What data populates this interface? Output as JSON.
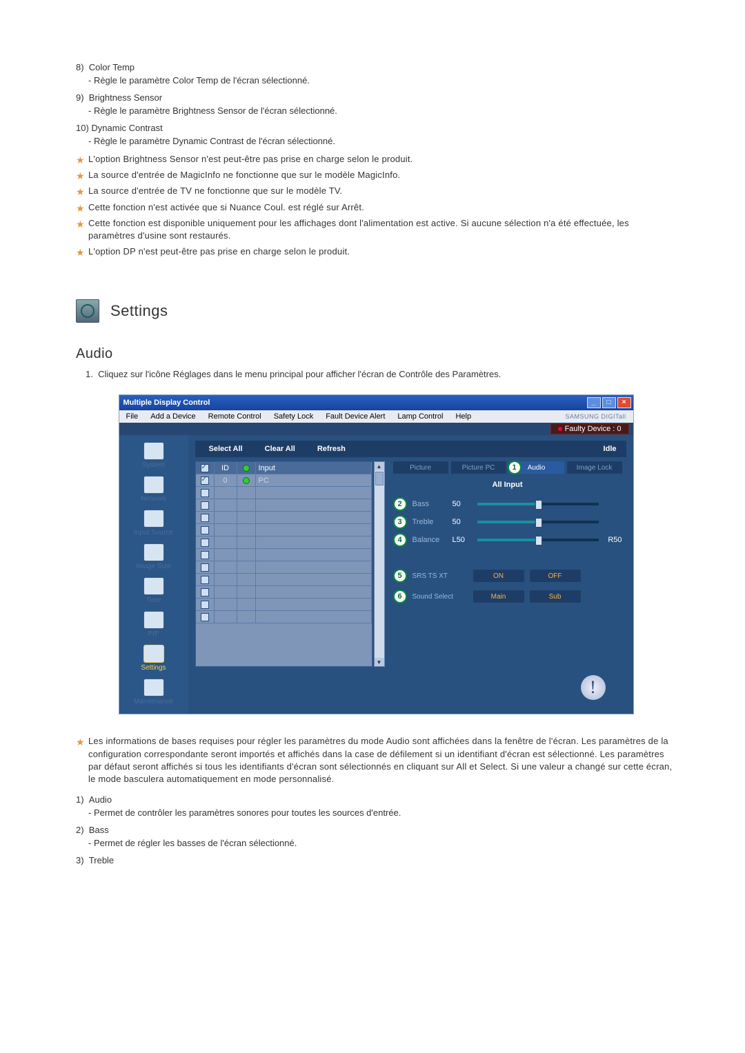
{
  "top_list": [
    {
      "num": "8)",
      "title": "Color Temp",
      "desc": "- Règle le paramètre Color Temp de l'écran sélectionné."
    },
    {
      "num": "9)",
      "title": "Brightness Sensor",
      "desc": "- Règle le paramètre Brightness Sensor de l'écran sélectionné."
    },
    {
      "num": "10)",
      "title": "Dynamic Contrast",
      "desc": "- Règle le paramètre Dynamic Contrast de l'écran sélectionné."
    }
  ],
  "star_notes": [
    "L'option Brightness Sensor n'est peut-être pas prise en charge selon le produit.",
    "La source d'entrée de MagicInfo ne fonctionne que sur le modèle MagicInfo.",
    "La source d'entrée de TV ne fonctionne que sur le modèle TV.",
    "Cette fonction n'est activée que si Nuance Coul. est réglé sur Arrêt.",
    "Cette fonction est disponible uniquement pour les affichages dont l'alimentation est active. Si aucune sélection n'a été effectuée, les paramètres d'usine sont restaurés.",
    "L'option DP n'est peut-être pas prise en charge selon le produit."
  ],
  "section_title": "Settings",
  "audio_heading": "Audio",
  "audio_intro_num": "1.",
  "audio_intro": "Cliquez sur l'icône Réglages dans le menu principal pour afficher l'écran de Contrôle des Paramètres.",
  "shot": {
    "title": "Multiple Display Control",
    "menu": [
      "File",
      "Add a Device",
      "Remote Control",
      "Safety Lock",
      "Fault Device Alert",
      "Lamp Control",
      "Help"
    ],
    "brand": "SAMSUNG DIGITall",
    "faulty": "Faulty Device : 0",
    "toolbar": {
      "select_all": "Select All",
      "clear_all": "Clear All",
      "refresh": "Refresh",
      "idle": "Idle"
    },
    "sidebar": [
      "System",
      "Network",
      "Input Source",
      "Image Size",
      "Time",
      "PIP",
      "Settings",
      "Maintenance"
    ],
    "grid_headers": {
      "c2": "ID",
      "c4": "Input"
    },
    "grid_row": {
      "id": "0",
      "input": "PC"
    },
    "tabs": [
      "Picture",
      "Picture PC",
      "Audio",
      "Image Lock"
    ],
    "all_input": "All Input",
    "sliders": {
      "bass": {
        "label": "Bass",
        "value": "50"
      },
      "treble": {
        "label": "Treble",
        "value": "50"
      },
      "balance": {
        "label": "Balance",
        "left": "L50",
        "right": "R50"
      }
    },
    "opts": {
      "srs": {
        "label": "SRS TS XT",
        "on": "ON",
        "off": "OFF"
      },
      "sound": {
        "label": "Sound Select",
        "a": "Main",
        "b": "Sub"
      }
    },
    "callouts": {
      "audio_tab": "1",
      "bass": "2",
      "treble": "3",
      "balance": "4",
      "srs": "5",
      "sound": "6"
    }
  },
  "post_star": "Les informations de bases requises pour régler les paramètres du mode Audio sont affichées dans la fenêtre de l'écran. Les paramètres de la configuration correspondante seront importés et affichés dans la case de défilement si un identifiant d'écran est sélectionné. Les paramètres par défaut seront affichés si tous les identifiants d'écran sont sélectionnés en cliquant sur All et Select. Si une valeur a changé sur cette écran, le mode basculera automatiquement en mode personnalisé.",
  "bottom_list": [
    {
      "num": "1)",
      "title": "Audio",
      "desc": "- Permet de contrôler les paramètres sonores pour toutes les sources d'entrée."
    },
    {
      "num": "2)",
      "title": "Bass",
      "desc": "- Permet de régler les basses de l'écran sélectionné."
    },
    {
      "num": "3)",
      "title": "Treble",
      "desc": ""
    }
  ]
}
